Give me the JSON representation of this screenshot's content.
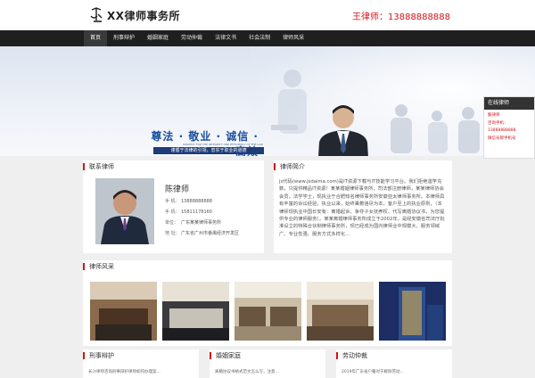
{
  "header": {
    "logo_text": "XX律师事务所",
    "phone": "王律师：13888888888"
  },
  "nav": {
    "items": [
      "首页",
      "刑事辩护",
      "婚姻家庭",
      "劳动仲裁",
      "法律文书",
      "社会法制",
      "律师风采"
    ]
  },
  "banner": {
    "slogan": "尊法 · 敬业 · 诚信 · 高效",
    "slogan_en": "RESPECT FOR THE INTEGRITY AND EFFICIENCY OF THE LAW",
    "slogan_sub": "谨循于法律的引领，忠实于职业的道德"
  },
  "online": {
    "title": "在线律师",
    "lines": [
      "甄律师",
      "咨询手机：",
      "13888888888",
      "微信号即手机号"
    ]
  },
  "contact": {
    "title": "联系律师",
    "name": "陈律师",
    "phone_label": "手  机：",
    "phone": "13888888888",
    "mobile_label": "手  机：",
    "mobile": "15811178160",
    "unit_label": "单位：",
    "unit": "广东某某律师事务所",
    "addr_label": "地  址：",
    "addr": "广东省广州市番禺经济开发区"
  },
  "intro": {
    "title": "律师简介",
    "text": "js代码(www.jsdaima.com)是IT资源下载与IT技能学习平台。我们拒绝滥竽充数，只提供精品IT资源！某某婚姻律师事务所，司法部注册律师，某某律师协会会员，法学学士，现执业于合肥知名律师事务所安徽亚太律师事务所。本律师具有丰富的诉讼经验，执业以来，始终秉着恪尽为本，客户至上的执业原则，（本律师现执业中国长安有：离婚起诉，争夺子女抚养权、代写离婚协议书，为您提供专业的律师服务）。某某离婚律师事务所成立于2002年，是经安徽省司法厅批准设立的特殊合伙制律师事务所，现已经成为国内律师业中规模大、服务领域广、专业性强、服务方式多样化..."
  },
  "gallery": {
    "title": "律师风采"
  },
  "bottom": [
    {
      "title": "刑事辩护",
      "line": "长沙律师咨询刑事辩护律师如何办理案..."
    },
    {
      "title": "婚姻家庭",
      "line": "离婚协议书格式范文怎么写，注意..."
    },
    {
      "title": "劳动仲裁",
      "line": "2019年广东省户籍对于解除劳动..."
    }
  ],
  "colors": {
    "accent": "#d2131c",
    "nav_bg": "#1f1f1f",
    "slogan": "#1b4f9e"
  }
}
